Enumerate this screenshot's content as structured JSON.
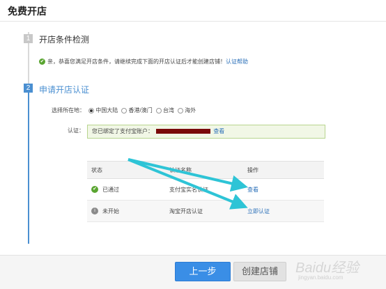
{
  "header": {
    "title": "免费开店"
  },
  "steps": [
    {
      "num": "1",
      "title": "开店条件检测"
    },
    {
      "num": "2",
      "title": "申请开店认证"
    }
  ],
  "tip": {
    "text": "亲，恭喜您满足开店条件，请继续完成下面的开店认证后才能创建店铺！",
    "link": "认证帮助"
  },
  "region": {
    "label": "选择所在地：",
    "options": [
      "中国大陆",
      "香港/澳门",
      "台湾",
      "海外"
    ],
    "selected": "中国大陆"
  },
  "cert": {
    "label": "认证：",
    "text": "您已绑定了支付宝账户：",
    "link": "查看"
  },
  "table": {
    "headers": [
      "状态",
      "认证名称",
      "操作"
    ],
    "rows": [
      {
        "status": "已通过",
        "name": "支付宝实名认证",
        "action": "查看"
      },
      {
        "status": "未开始",
        "name": "淘宝开店认证",
        "action": "立即认证"
      }
    ]
  },
  "buttons": {
    "prev": "上一步",
    "create": "创建店铺"
  },
  "watermark": {
    "brand": "Baidu经验",
    "url": "jingyan.baidu.com"
  },
  "colors": {
    "accent": "#4a8fd1",
    "success": "#5aa531",
    "link": "#2a6fb8",
    "arrow": "#2ec4d6",
    "primary_button": "#3a8ee6"
  }
}
